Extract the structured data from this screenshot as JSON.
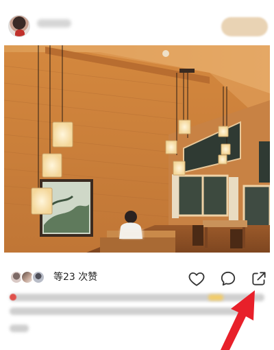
{
  "header": {
    "avatar_icon": "user-avatar",
    "follow_button": {
      "color": "#e9d3b4"
    }
  },
  "post": {
    "photo_icon": "room-photo"
  },
  "likes": {
    "text": "等23 次赞"
  },
  "actions": {
    "like_icon": "heart-icon",
    "comment_icon": "comment-bubble-icon",
    "share_icon": "share-arrow-icon"
  },
  "annotation": {
    "color": "#e8202a",
    "icon": "red-arrow-pointing-to-share"
  }
}
